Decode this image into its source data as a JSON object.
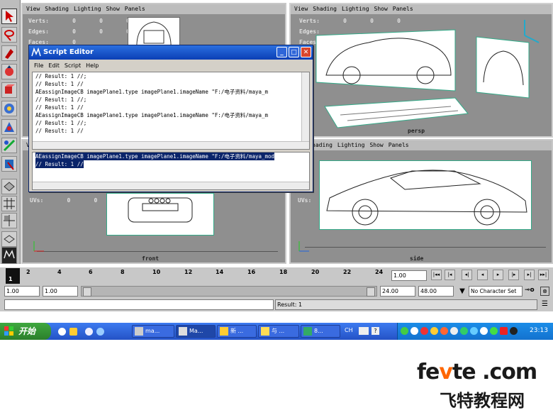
{
  "viewports": {
    "menu": [
      "View",
      "Shading",
      "Lighting",
      "Show",
      "Panels"
    ],
    "partial_menu": [
      "hading",
      "Lighting",
      "Show",
      "Panels"
    ],
    "hud_labels": {
      "verts": "Verts:",
      "edges": "Edges:",
      "faces": "Faces:",
      "uvs": "UVs:"
    },
    "hud_zero": "0",
    "labels": {
      "persp": "persp",
      "front": "front",
      "side": "side"
    },
    "axis": {
      "y": "y",
      "z": "z",
      "x": "x"
    }
  },
  "script_editor": {
    "title": "Script Editor",
    "menu": [
      "File",
      "Edit",
      "Script",
      "Help"
    ],
    "history": [
      "// Result: 1 //;",
      "// Result: 1 //",
      "AEassignImageCB imagePlane1.type imagePlane1.imageName \"F:/电子资料/maya_m",
      "// Result: 1 //;",
      "// Result: 1 //",
      "AEassignImageCB imagePlane1.type imagePlane1.imageName \"F:/电子资料/maya_m",
      "// Result: 1 //;",
      "// Result: 1 //"
    ],
    "input": [
      "AEassignImageCB imagePlane1.type imagePlane1.imageName \"F:/电子资料/maya_mod",
      "// Result: 1 //"
    ]
  },
  "timeline": {
    "ticks": [
      "1",
      "2",
      "4",
      "6",
      "8",
      "10",
      "12",
      "14",
      "16",
      "18",
      "20",
      "22",
      "24"
    ],
    "current_frame": "1.00",
    "playback_buttons": [
      "|◂◂",
      "|◂",
      "◂|",
      "◂",
      "▸",
      "|▸",
      "▸|",
      "▸▸|"
    ]
  },
  "range": {
    "start": "1.00",
    "playback_start": "1.00",
    "playback_end": "24.00",
    "end": "48.00",
    "character_set": "No Character Set"
  },
  "command_line": {
    "result": "Result: 1"
  },
  "taskbar": {
    "start_label": "开始",
    "tasks": [
      "ma...",
      "Ma...",
      "新 ...",
      "与 ...",
      "8..."
    ],
    "lang": "CH",
    "clock": "23:13"
  },
  "watermark": {
    "line1": "fevte .com",
    "line2": "飞特教程网",
    "accent": "#ff6600"
  }
}
